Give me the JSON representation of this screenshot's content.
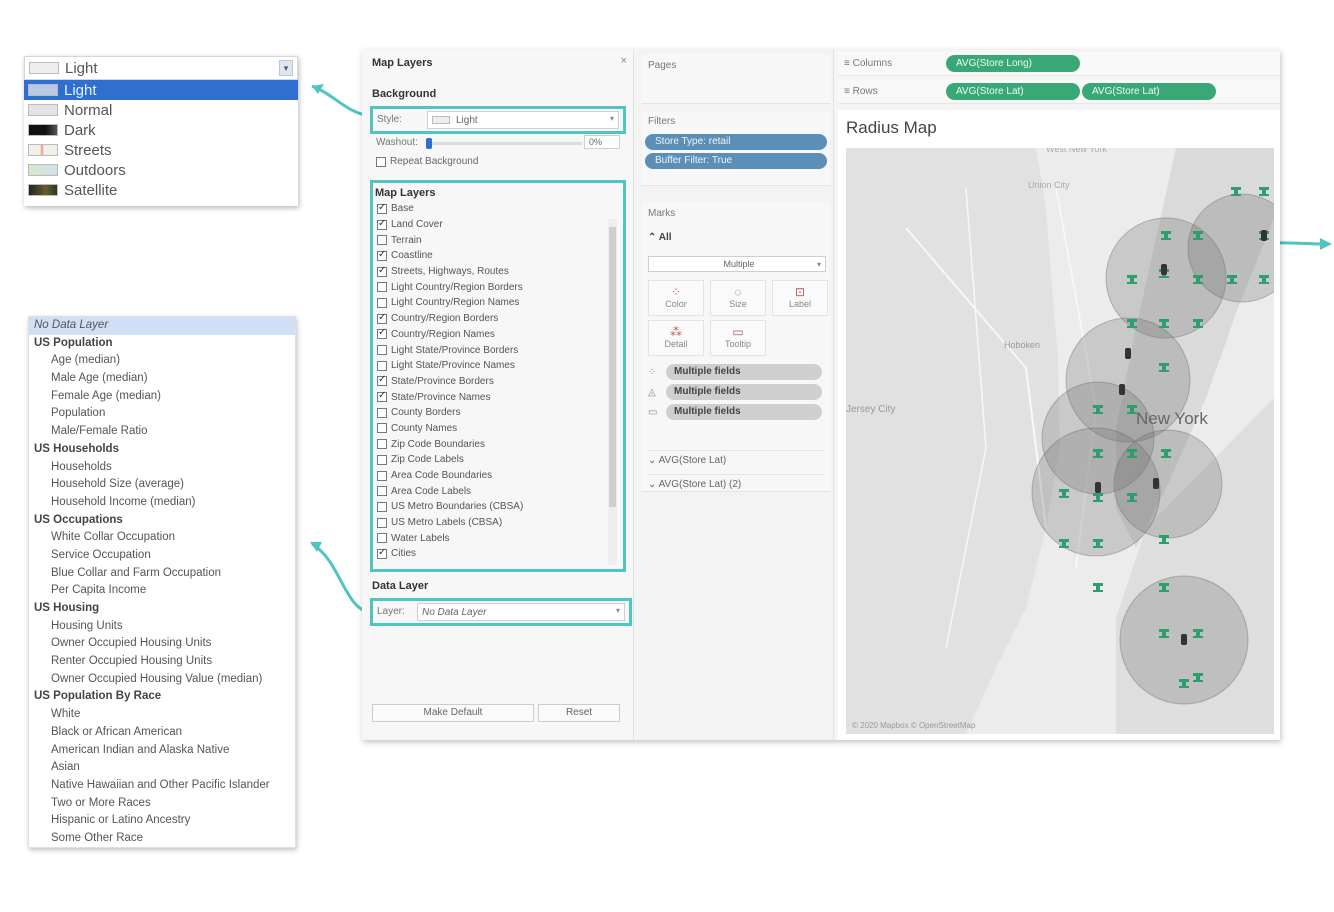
{
  "style_popup": {
    "current": "Light",
    "options": [
      {
        "label": "Light",
        "swatch": "sw-light-sel",
        "selected": true
      },
      {
        "label": "Normal",
        "swatch": "sw-normal",
        "selected": false
      },
      {
        "label": "Dark",
        "swatch": "sw-dark",
        "selected": false
      },
      {
        "label": "Streets",
        "swatch": "sw-streets",
        "selected": false
      },
      {
        "label": "Outdoors",
        "swatch": "sw-outdoors",
        "selected": false
      },
      {
        "label": "Satellite",
        "swatch": "sw-satellite",
        "selected": false
      }
    ]
  },
  "data_layer_list": {
    "first": "No Data Layer",
    "groups": [
      {
        "title": "US Population",
        "items": [
          "Age (median)",
          "Male Age (median)",
          "Female Age (median)",
          "Population",
          "Male/Female Ratio"
        ]
      },
      {
        "title": "US Households",
        "items": [
          "Households",
          "Household Size (average)",
          "Household Income (median)"
        ]
      },
      {
        "title": "US Occupations",
        "items": [
          "White Collar Occupation",
          "Service Occupation",
          "Blue Collar and Farm Occupation",
          "Per Capita Income"
        ]
      },
      {
        "title": "US Housing",
        "items": [
          "Housing Units",
          "Owner Occupied Housing Units",
          "Renter Occupied Housing Units",
          "Owner Occupied Housing Value (median)"
        ]
      },
      {
        "title": "US Population By Race",
        "items": [
          "White",
          "Black or African American",
          "American Indian and Alaska Native",
          "Asian",
          "Native Hawaiian and Other Pacific Islander",
          "Two or More Races",
          "Hispanic or Latino Ancestry",
          "Some Other Race"
        ]
      }
    ]
  },
  "map_layers_pane": {
    "title": "Map Layers",
    "close": "×",
    "background_title": "Background",
    "style_label": "Style:",
    "style_value": "Light",
    "washout_label": "Washout:",
    "washout_value": "0%",
    "washout_fraction": 0.0,
    "repeat_label": "Repeat Background",
    "layers_title": "Map Layers",
    "layers": [
      {
        "label": "Base",
        "checked": true
      },
      {
        "label": "Land Cover",
        "checked": true
      },
      {
        "label": "Terrain",
        "checked": false
      },
      {
        "label": "Coastline",
        "checked": true
      },
      {
        "label": "Streets, Highways, Routes",
        "checked": true
      },
      {
        "label": "Light Country/Region Borders",
        "checked": false
      },
      {
        "label": "Light Country/Region Names",
        "checked": false
      },
      {
        "label": "Country/Region Borders",
        "checked": true
      },
      {
        "label": "Country/Region Names",
        "checked": true
      },
      {
        "label": "Light State/Province Borders",
        "checked": false
      },
      {
        "label": "Light State/Province Names",
        "checked": false
      },
      {
        "label": "State/Province Borders",
        "checked": true
      },
      {
        "label": "State/Province Names",
        "checked": true
      },
      {
        "label": "County Borders",
        "checked": false
      },
      {
        "label": "County Names",
        "checked": false
      },
      {
        "label": "Zip Code Boundaries",
        "checked": false
      },
      {
        "label": "Zip Code Labels",
        "checked": false
      },
      {
        "label": "Area Code Boundaries",
        "checked": false
      },
      {
        "label": "Area Code Labels",
        "checked": false
      },
      {
        "label": "US Metro Boundaries (CBSA)",
        "checked": false
      },
      {
        "label": "US Metro Labels (CBSA)",
        "checked": false
      },
      {
        "label": "Water Labels",
        "checked": false
      },
      {
        "label": "Cities",
        "checked": true
      }
    ],
    "data_layer_title": "Data Layer",
    "layer_label": "Layer:",
    "layer_value": "No Data Layer",
    "make_default": "Make Default",
    "reset": "Reset"
  },
  "mid_pane": {
    "pages_label": "Pages",
    "filters_label": "Filters",
    "filters": [
      "Store Type: retail",
      "Buffer Filter: True"
    ],
    "marks_label": "Marks",
    "all_label": "All",
    "mark_type": "Multiple",
    "mark_buttons": [
      "Color",
      "Size",
      "Label",
      "Detail",
      "Tooltip"
    ],
    "multi_fields": [
      "Multiple fields",
      "Multiple fields",
      "Multiple fields"
    ],
    "measures": [
      "AVG(Store Lat)",
      "AVG(Store Lat) (2)"
    ]
  },
  "right_pane": {
    "columns_label": "Columns",
    "rows_label": "Rows",
    "columns_pills": [
      "AVG(Store Long)"
    ],
    "rows_pills": [
      "AVG(Store Lat)",
      "AVG(Store Lat)"
    ],
    "map_title": "Radius Map",
    "place_labels": [
      "West New York",
      "Union City",
      "Hoboken",
      "Jersey City",
      "New York"
    ],
    "attribution": "© 2020 Mapbox © OpenStreetMap"
  },
  "colors": {
    "highlight": "#4fc5c0",
    "selection": "#2f6fd0",
    "filter_pill": "#5b8fb8",
    "shelf_pill": "#3aa876",
    "marker": "#2e9e6e"
  }
}
